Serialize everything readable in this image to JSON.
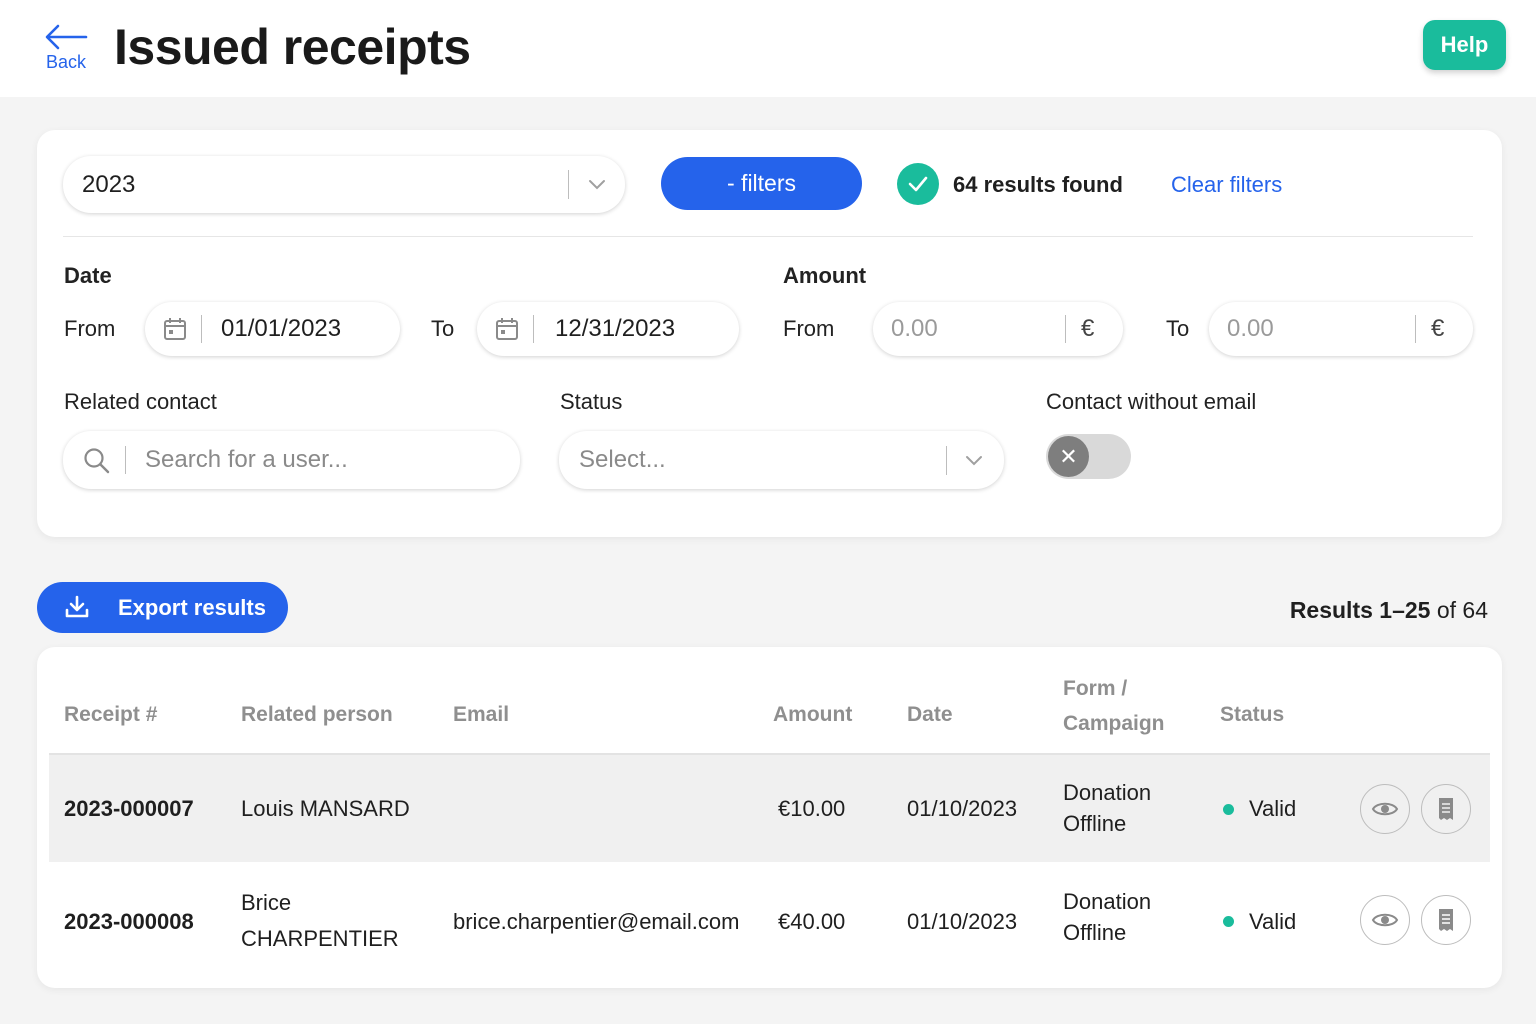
{
  "header": {
    "back_label": "Back",
    "title": "Issued receipts",
    "help_label": "Help"
  },
  "filters": {
    "year_value": "2023",
    "filters_button": "- filters",
    "results_found": "64 results found",
    "clear_filters": "Clear filters",
    "date": {
      "label": "Date",
      "from_label": "From",
      "from_value": "01/01/2023",
      "to_label": "To",
      "to_value": "12/31/2023"
    },
    "amount": {
      "label": "Amount",
      "from_label": "From",
      "from_placeholder": "0.00",
      "to_label": "To",
      "to_placeholder": "0.00",
      "currency": "€"
    },
    "related_contact": {
      "label": "Related contact",
      "placeholder": "Search for a user..."
    },
    "status": {
      "label": "Status",
      "placeholder": "Select..."
    },
    "contact_without_email": {
      "label": "Contact without email",
      "enabled": false
    }
  },
  "results": {
    "export_label": "Export results",
    "range_bold": "Results 1–25",
    "range_rest": " of 64"
  },
  "table": {
    "headers": {
      "receipt": "Receipt #",
      "person": "Related person",
      "email": "Email",
      "amount": "Amount",
      "date": "Date",
      "form_line1": "Form /",
      "form_line2": "Campaign",
      "status": "Status"
    },
    "rows": [
      {
        "receipt": "2023-000007",
        "person_line1": "Louis MANSARD",
        "person_line2": "",
        "email": "",
        "amount": "€10.00",
        "date": "01/10/2023",
        "form_line1": "Donation",
        "form_line2": "Offline",
        "status": "Valid"
      },
      {
        "receipt": "2023-000008",
        "person_line1": "Brice",
        "person_line2": "CHARPENTIER",
        "email": "brice.charpentier@email.com",
        "amount": "€40.00",
        "date": "01/10/2023",
        "form_line1": "Donation",
        "form_line2": "Offline",
        "status": "Valid"
      }
    ]
  },
  "colors": {
    "primary": "#2563eb",
    "accent": "#1abc9c",
    "background": "#f4f4f4"
  }
}
